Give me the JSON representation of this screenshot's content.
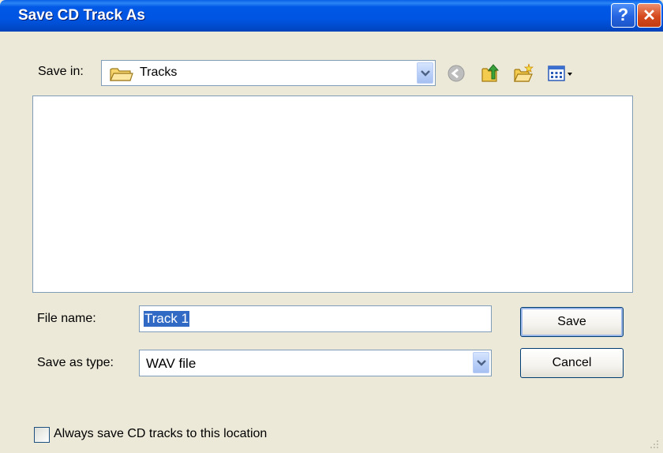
{
  "window": {
    "title": "Save CD Track As",
    "help_glyph": "?",
    "close_glyph": "✕"
  },
  "save_in": {
    "label": "Save in:",
    "value": "Tracks",
    "icon": "folder-icon"
  },
  "toolbar": {
    "icons": [
      "back-icon",
      "up-folder-icon",
      "new-folder-icon",
      "views-menu-icon"
    ]
  },
  "file_list": {
    "items": []
  },
  "file_name": {
    "label": "File name:",
    "value": "Track 1"
  },
  "save_as_type": {
    "label": "Save as type:",
    "value": "WAV file"
  },
  "buttons": {
    "save": "Save",
    "cancel": "Cancel"
  },
  "always_save": {
    "label": "Always save CD tracks to this location",
    "checked": false
  },
  "colors": {
    "titlebar": "#0055E2",
    "dialog_bg": "#ECE9D8",
    "selection": "#316AC5",
    "input_border": "#7F9DB9"
  }
}
